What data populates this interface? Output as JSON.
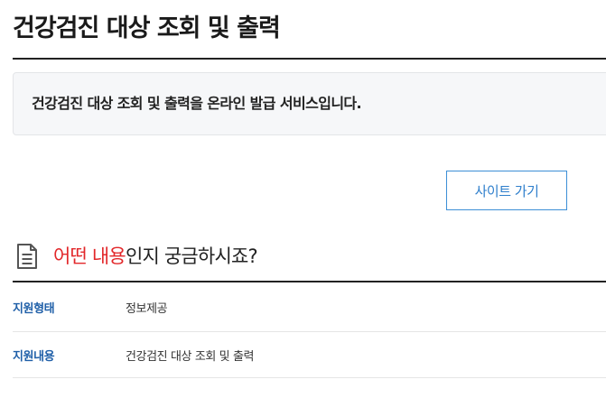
{
  "header": {
    "title": "건강검진 대상 조회 및 출력"
  },
  "notice": {
    "text": "건강검진 대상 조회 및 출력을 온라인 발급 서비스입니다."
  },
  "actions": {
    "site_button_label": "사이트 가기"
  },
  "section": {
    "title_accent": "어떤 내용",
    "title_rest": "인지 궁금하시죠?",
    "icon": "document-icon"
  },
  "info": {
    "rows": [
      {
        "key": "지원형태",
        "value": "정보제공"
      },
      {
        "key": "지원내용",
        "value": "건강검진 대상 조회 및 출력"
      }
    ]
  },
  "colors": {
    "accent_red": "#e2272a",
    "link_blue": "#2f7fcc",
    "key_blue": "#1f5fa8"
  }
}
